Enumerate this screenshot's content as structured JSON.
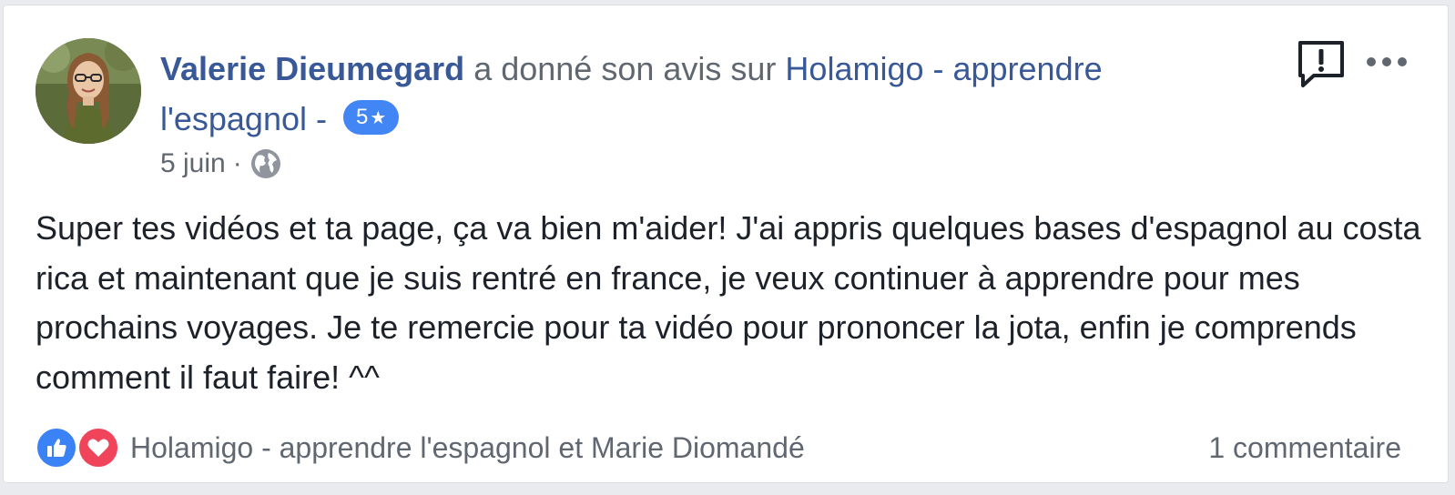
{
  "post": {
    "author": "Valerie Dieumegard",
    "action_text": "a donné son avis sur",
    "page_name_line1": "Holamigo - apprendre",
    "page_name_line2": "l'espagnol -",
    "rating": "5",
    "rating_star": "★",
    "date": "5 juin",
    "separator": "·",
    "body": "Super tes vidéos et ta page, ça va bien m'aider! J'ai appris quelques bases d'espagnol au costa rica et maintenant que je suis rentré en france, je veux continuer à apprendre pour mes prochains voyages. Je te remercie pour ta vidéo pour prononcer la jota, enfin je comprends comment il faut faire! ^^"
  },
  "footer": {
    "reacted_by": "Holamigo - apprendre l'espagnol et Marie Diomandé",
    "comments": "1 commentaire"
  },
  "icons": {
    "privacy": "globe-icon",
    "report": "report-icon",
    "more": "more-icon",
    "like": "like-icon",
    "love": "love-icon"
  },
  "colors": {
    "link": "#385898",
    "secondary_text": "#616770",
    "body_text": "#1d2129",
    "rating_badge": "#4285f4",
    "like": "#3b82f6",
    "love": "#f0445a"
  }
}
